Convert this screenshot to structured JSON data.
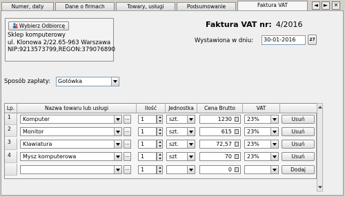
{
  "tabs": [
    {
      "label": "Numer, daty"
    },
    {
      "label": "Dane o firmach"
    },
    {
      "label": "Towary, usługi"
    },
    {
      "label": "Podsumowanie"
    },
    {
      "label": "Faktura VAT"
    }
  ],
  "seller": {
    "choose_button": "Wybierz Odbiorcę",
    "name": "Sklep komputerowy",
    "address": "ul. Klonowa 2/22.65-963 Warszawa",
    "ids": "NIP:9213573799,REGON:379076890"
  },
  "invoice": {
    "title": "Faktura VAT nr:",
    "number": "4/2016",
    "issued_label": "Wystawiona w dniu:",
    "issued_date": "30-01-2016",
    "calendar_button": "27"
  },
  "payment": {
    "label": "Sposób zapłaty:",
    "value": "Gotówka"
  },
  "table": {
    "headers": {
      "lp": "Lp.",
      "name": "Nazwa towaru lub usługi",
      "qty": "Ilość",
      "unit": "Jednostka",
      "price": "Cena Brutto",
      "vat": "VAT"
    },
    "browse_label": "...",
    "rows": [
      {
        "lp": "1",
        "name": "Komputer",
        "qty": "1",
        "unit": "szt.",
        "price": "1230",
        "vat": "23%",
        "action": "Usuń"
      },
      {
        "lp": "2",
        "name": "Monitor",
        "qty": "1",
        "unit": "szt.",
        "price": "615",
        "vat": "23%",
        "action": "Usuń"
      },
      {
        "lp": "3",
        "name": "Klawiatura",
        "qty": "1",
        "unit": "szt.",
        "price": "72,57",
        "vat": "23%",
        "action": "Usuń"
      },
      {
        "lp": "4",
        "name": "Mysz komputerowa",
        "qty": "1",
        "unit": "szt",
        "price": "70",
        "vat": "23%",
        "action": "Usuń"
      },
      {
        "lp": "",
        "name": "",
        "qty": "1",
        "unit": "",
        "price": "0",
        "vat": "",
        "action": "Dodaj"
      }
    ]
  },
  "window_controls": {
    "prev": "◄",
    "next": "►",
    "close": "✕"
  }
}
